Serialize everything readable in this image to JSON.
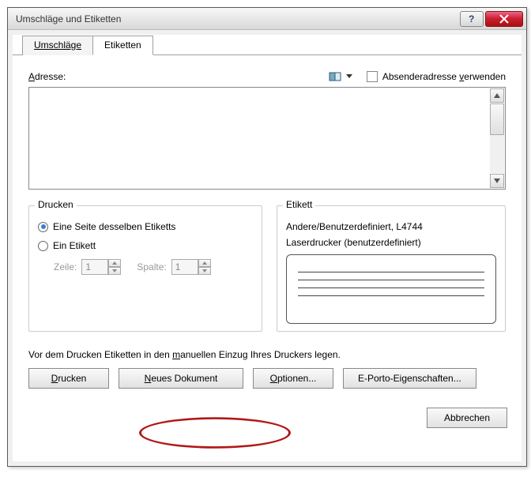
{
  "titlebar": {
    "title": "Umschläge und Etiketten"
  },
  "tabs": {
    "umschlaege": "Umschläge",
    "etiketten": "Etiketten"
  },
  "adresse": {
    "label_pre": "A",
    "label_rest": "dresse:",
    "absender_pre": "Absenderadresse ",
    "absender_u": "v",
    "absender_post": "erwenden"
  },
  "drucken": {
    "title": "Drucken",
    "opt_page": "Eine Seite desselben Etiketts",
    "opt_single": "Ein Etikett",
    "zeile": "Zeile:",
    "spalte": "Spalte:",
    "zeile_val": "1",
    "spalte_val": "1"
  },
  "etikett": {
    "title": "Etikett",
    "line1": "Andere/Benutzerdefiniert, L4744",
    "line2": "Laserdrucker (benutzerdefiniert)"
  },
  "hint": {
    "pre": "Vor dem Drucken Etiketten in den ",
    "u": "m",
    "post": "anuellen Einzug Ihres Druckers legen."
  },
  "buttons": {
    "drucken_u": "D",
    "drucken_rest": "rucken",
    "neues_u": "N",
    "neues_rest": "eues Dokument",
    "optionen_u": "O",
    "optionen_rest": "ptionen...",
    "eporto": "E-Porto-Eigenschaften...",
    "abbrechen": "Abbrechen"
  }
}
